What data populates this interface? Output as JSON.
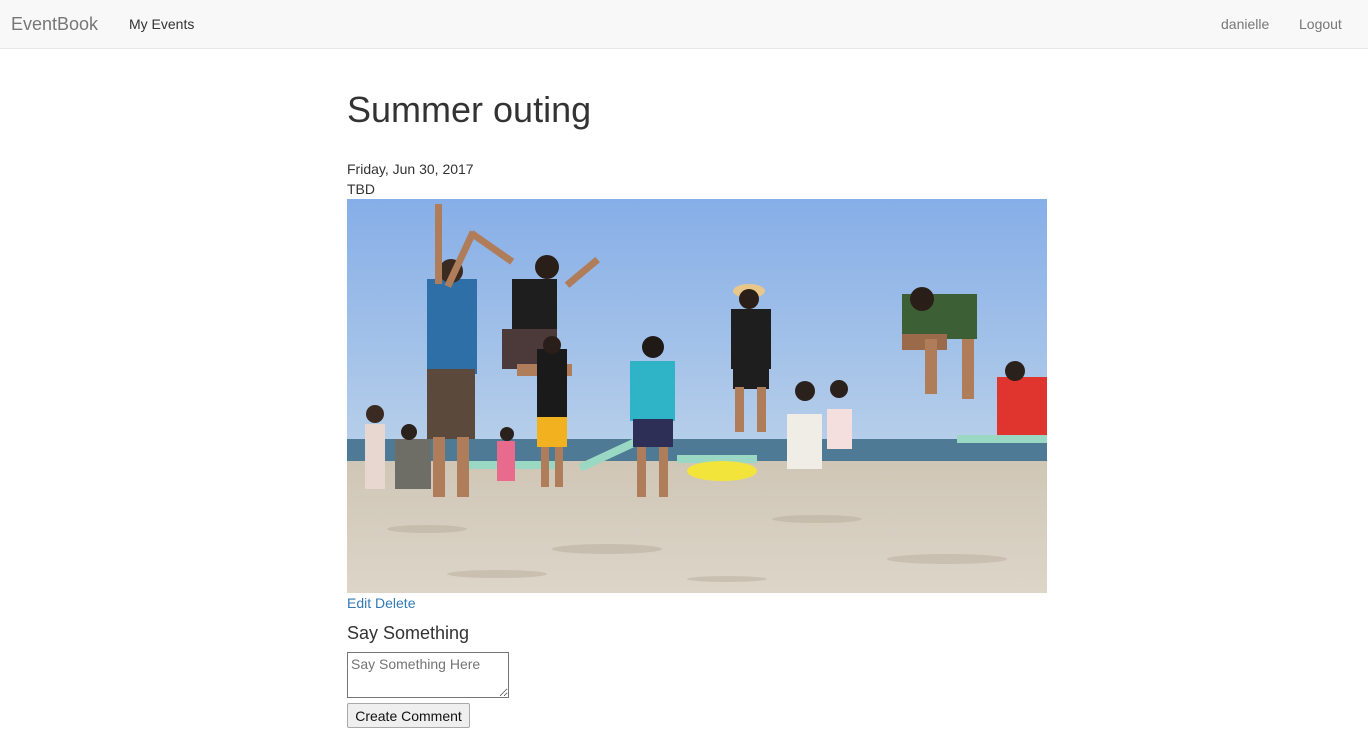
{
  "navbar": {
    "brand": "EventBook",
    "my_events": "My Events",
    "username": "danielle",
    "logout": "Logout"
  },
  "event": {
    "title": "Summer outing",
    "date": "Friday, Jun 30, 2017",
    "location": "TBD",
    "photo_icon": "event-photo",
    "edit_label": "Edit",
    "delete_label": "Delete"
  },
  "comment": {
    "heading": "Say Something",
    "placeholder": "Say Something Here",
    "submit_label": "Create Comment"
  },
  "colors": {
    "navbar_bg": "#f8f8f8",
    "link": "#337ab7",
    "sky": "#8fb6e6",
    "sand": "#d9d0c2"
  }
}
